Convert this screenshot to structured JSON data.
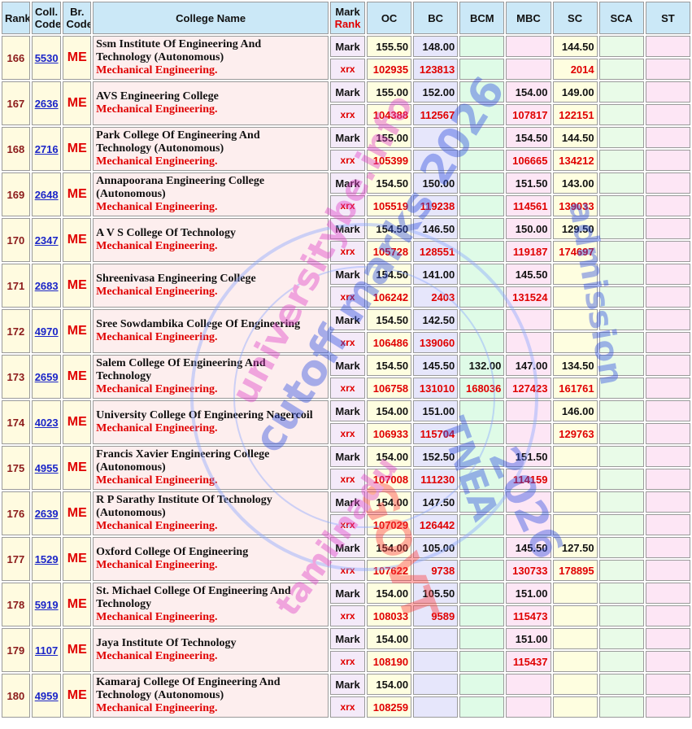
{
  "headers": {
    "rank": "Rank",
    "coll_code": "Coll. Code",
    "br_code": "Br. Code",
    "college_name": "College Name",
    "mark_top": "Mark",
    "mark_bottom": "Rank",
    "oc": "OC",
    "bc": "BC",
    "bcm": "BCM",
    "mbc": "MBC",
    "sc": "SC",
    "sca": "SCA",
    "st": "ST"
  },
  "row_labels": {
    "mark": "Mark",
    "rank": "xrx"
  },
  "branch_code": "ME",
  "branch_name": "Mechanical Engineering.",
  "watermark": [
    "universitybe.info",
    "cutoff marks 2026",
    "GOVT",
    "TNEA",
    "2026",
    "admission",
    "tamilnadu"
  ],
  "rows": [
    {
      "rank": "166",
      "code": "5530",
      "name": [
        "Ssm Institute Of Engineering And",
        "Technology (Autonomous)"
      ],
      "marks": {
        "oc": "155.50",
        "bc": "148.00",
        "bcm": "",
        "mbc": "",
        "sc": "144.50",
        "sca": "",
        "st": ""
      },
      "ranks": {
        "oc": "102935",
        "bc": "123813",
        "bcm": "",
        "mbc": "",
        "sc": "2014",
        "sca": "",
        "st": ""
      }
    },
    {
      "rank": "167",
      "code": "2636",
      "name": [
        "AVS Engineering College"
      ],
      "marks": {
        "oc": "155.00",
        "bc": "152.00",
        "bcm": "",
        "mbc": "154.00",
        "sc": "149.00",
        "sca": "",
        "st": ""
      },
      "ranks": {
        "oc": "104388",
        "bc": "112567",
        "bcm": "",
        "mbc": "107817",
        "sc": "122151",
        "sca": "",
        "st": ""
      }
    },
    {
      "rank": "168",
      "code": "2716",
      "name": [
        "Park College Of Engineering And",
        "Technology (Autonomous)"
      ],
      "marks": {
        "oc": "155.00",
        "bc": "",
        "bcm": "",
        "mbc": "154.50",
        "sc": "144.50",
        "sca": "",
        "st": ""
      },
      "ranks": {
        "oc": "105399",
        "bc": "",
        "bcm": "",
        "mbc": "106665",
        "sc": "134212",
        "sca": "",
        "st": ""
      }
    },
    {
      "rank": "169",
      "code": "2648",
      "name": [
        "Annapoorana Engineering College",
        "(Autonomous)"
      ],
      "marks": {
        "oc": "154.50",
        "bc": "150.00",
        "bcm": "",
        "mbc": "151.50",
        "sc": "143.00",
        "sca": "",
        "st": ""
      },
      "ranks": {
        "oc": "105519",
        "bc": "119238",
        "bcm": "",
        "mbc": "114561",
        "sc": "139033",
        "sca": "",
        "st": ""
      }
    },
    {
      "rank": "170",
      "code": "2347",
      "name": [
        "A V S College Of Technology"
      ],
      "marks": {
        "oc": "154.50",
        "bc": "146.50",
        "bcm": "",
        "mbc": "150.00",
        "sc": "129.50",
        "sca": "",
        "st": ""
      },
      "ranks": {
        "oc": "105728",
        "bc": "128551",
        "bcm": "",
        "mbc": "119187",
        "sc": "174697",
        "sca": "",
        "st": ""
      }
    },
    {
      "rank": "171",
      "code": "2683",
      "name": [
        "Shreenivasa Engineering College"
      ],
      "marks": {
        "oc": "154.50",
        "bc": "141.00",
        "bcm": "",
        "mbc": "145.50",
        "sc": "",
        "sca": "",
        "st": ""
      },
      "ranks": {
        "oc": "106242",
        "bc": "2403",
        "bcm": "",
        "mbc": "131524",
        "sc": "",
        "sca": "",
        "st": ""
      }
    },
    {
      "rank": "172",
      "code": "4970",
      "name": [
        "Sree Sowdambika College Of Engineering"
      ],
      "marks": {
        "oc": "154.50",
        "bc": "142.50",
        "bcm": "",
        "mbc": "",
        "sc": "",
        "sca": "",
        "st": ""
      },
      "ranks": {
        "oc": "106486",
        "bc": "139060",
        "bcm": "",
        "mbc": "",
        "sc": "",
        "sca": "",
        "st": ""
      }
    },
    {
      "rank": "173",
      "code": "2659",
      "name": [
        "Salem College Of Engineering And",
        "Technology"
      ],
      "marks": {
        "oc": "154.50",
        "bc": "145.50",
        "bcm": "132.00",
        "mbc": "147.00",
        "sc": "134.50",
        "sca": "",
        "st": ""
      },
      "ranks": {
        "oc": "106758",
        "bc": "131010",
        "bcm": "168036",
        "mbc": "127423",
        "sc": "161761",
        "sca": "",
        "st": ""
      }
    },
    {
      "rank": "174",
      "code": "4023",
      "name": [
        "University College Of Engineering Nagercoil"
      ],
      "marks": {
        "oc": "154.00",
        "bc": "151.00",
        "bcm": "",
        "mbc": "",
        "sc": "146.00",
        "sca": "",
        "st": ""
      },
      "ranks": {
        "oc": "106933",
        "bc": "115704",
        "bcm": "",
        "mbc": "",
        "sc": "129763",
        "sca": "",
        "st": ""
      }
    },
    {
      "rank": "175",
      "code": "4955",
      "name": [
        "Francis Xavier Engineering College",
        "(Autonomous)"
      ],
      "marks": {
        "oc": "154.00",
        "bc": "152.50",
        "bcm": "",
        "mbc": "151.50",
        "sc": "",
        "sca": "",
        "st": ""
      },
      "ranks": {
        "oc": "107008",
        "bc": "111230",
        "bcm": "",
        "mbc": "114159",
        "sc": "",
        "sca": "",
        "st": ""
      }
    },
    {
      "rank": "176",
      "code": "2639",
      "name": [
        "R P Sarathy Institute Of Technology",
        "(Autonomous)"
      ],
      "marks": {
        "oc": "154.00",
        "bc": "147.50",
        "bcm": "",
        "mbc": "",
        "sc": "",
        "sca": "",
        "st": ""
      },
      "ranks": {
        "oc": "107029",
        "bc": "126442",
        "bcm": "",
        "mbc": "",
        "sc": "",
        "sca": "",
        "st": ""
      }
    },
    {
      "rank": "177",
      "code": "1529",
      "name": [
        "Oxford College Of Engineering"
      ],
      "marks": {
        "oc": "154.00",
        "bc": "105.00",
        "bcm": "",
        "mbc": "145.50",
        "sc": "127.50",
        "sca": "",
        "st": ""
      },
      "ranks": {
        "oc": "107622",
        "bc": "9738",
        "bcm": "",
        "mbc": "130733",
        "sc": "178895",
        "sca": "",
        "st": ""
      }
    },
    {
      "rank": "178",
      "code": "5919",
      "name": [
        "St. Michael College Of Engineering And",
        "Technology"
      ],
      "marks": {
        "oc": "154.00",
        "bc": "105.50",
        "bcm": "",
        "mbc": "151.00",
        "sc": "",
        "sca": "",
        "st": ""
      },
      "ranks": {
        "oc": "108033",
        "bc": "9589",
        "bcm": "",
        "mbc": "115473",
        "sc": "",
        "sca": "",
        "st": ""
      }
    },
    {
      "rank": "179",
      "code": "1107",
      "name": [
        "Jaya Institute Of Technology"
      ],
      "marks": {
        "oc": "154.00",
        "bc": "",
        "bcm": "",
        "mbc": "151.00",
        "sc": "",
        "sca": "",
        "st": ""
      },
      "ranks": {
        "oc": "108190",
        "bc": "",
        "bcm": "",
        "mbc": "115437",
        "sc": "",
        "sca": "",
        "st": ""
      }
    },
    {
      "rank": "180",
      "code": "4959",
      "name": [
        "Kamaraj College Of Engineering And",
        "Technology (Autonomous)"
      ],
      "marks": {
        "oc": "154.00",
        "bc": "",
        "bcm": "",
        "mbc": "",
        "sc": "",
        "sca": "",
        "st": ""
      },
      "ranks": {
        "oc": "108259",
        "bc": "",
        "bcm": "",
        "mbc": "",
        "sc": "",
        "sca": "",
        "st": ""
      }
    }
  ]
}
